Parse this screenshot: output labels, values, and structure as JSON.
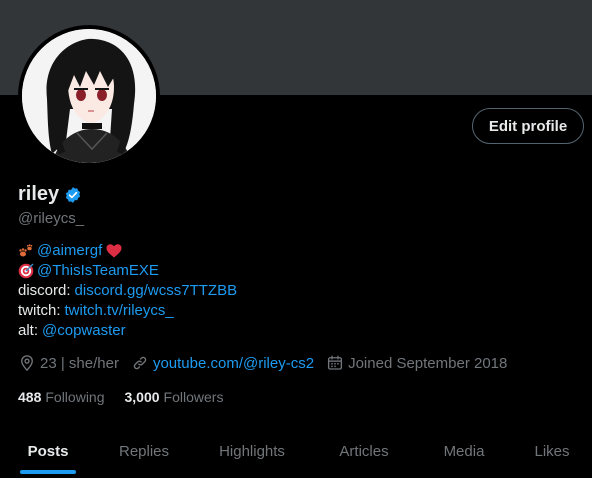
{
  "profile": {
    "display_name": "riley",
    "handle": "@rileycs_",
    "edit_button": "Edit profile"
  },
  "bio": {
    "line1": "@aimergf",
    "line2": "@ThisIsTeamEXE",
    "discord_label": "discord:",
    "discord_link": "discord.gg/wcss7TTZBB",
    "twitch_label": "twitch:",
    "twitch_link": "twitch.tv/rileycs_",
    "alt_label": "alt:",
    "alt_link": "@copwaster"
  },
  "meta": {
    "location": "23 | she/her",
    "website": "youtube.com/@riley-cs2",
    "joined": "Joined September 2018"
  },
  "stats": {
    "following_count": "488",
    "following_label": "Following",
    "followers_count": "3,000",
    "followers_label": "Followers"
  },
  "tabs": [
    "Posts",
    "Replies",
    "Highlights",
    "Articles",
    "Media",
    "Likes"
  ],
  "colors": {
    "accent": "#1d9bf0",
    "muted": "#71767b",
    "heart": "#f91880"
  }
}
